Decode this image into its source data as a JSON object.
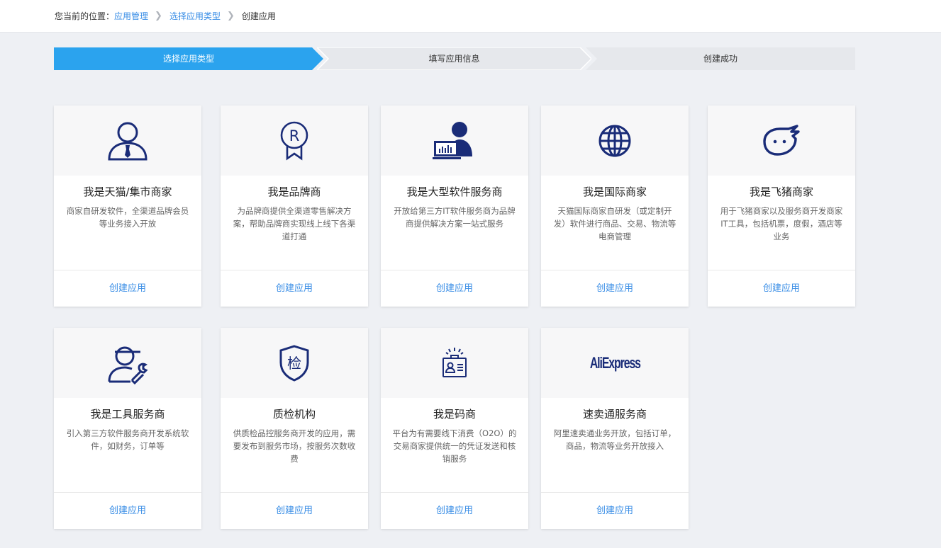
{
  "breadcrumb": {
    "prefix": "您当前的位置：",
    "items": [
      "应用管理",
      "选择应用类型",
      "创建应用"
    ]
  },
  "steps": [
    "选择应用类型",
    "填写应用信息",
    "创建成功"
  ],
  "colors": {
    "accent": "#2ba3ee",
    "link": "#3a8ee6",
    "icon": "#1a2c78"
  },
  "cards": [
    {
      "icon": "user-tie-icon",
      "title": "我是天猫/集市商家",
      "desc": "商家自研发软件，全渠道品牌会员等业务接入开放",
      "action": "创建应用"
    },
    {
      "icon": "registered-badge-icon",
      "title": "我是品牌商",
      "desc": "为品牌商提供全渠道零售解决方案，帮助品牌商实现线上线下各渠道打通",
      "action": "创建应用"
    },
    {
      "icon": "user-computer-icon",
      "title": "我是大型软件服务商",
      "desc": "开放给第三方IT软件服务商为品牌商提供解决方案一站式服务",
      "action": "创建应用"
    },
    {
      "icon": "globe-icon",
      "title": "我是国际商家",
      "desc": "天猫国际商家自研发（或定制开发）软件进行商品、交易、物流等电商管理",
      "action": "创建应用"
    },
    {
      "icon": "fliggy-icon",
      "title": "我是飞猪商家",
      "desc": "用于飞猪商家以及服务商开发商家IT工具，包括机票，度假，酒店等业务",
      "action": "创建应用"
    },
    {
      "icon": "user-wrench-icon",
      "title": "我是工具服务商",
      "desc": "引入第三方软件服务商开发系统软件，如财务，订单等",
      "action": "创建应用"
    },
    {
      "icon": "inspection-shield-icon",
      "title": "质检机构",
      "desc": "供质检品控服务商开发的应用，需要发布到服务市场，按服务次数收费",
      "action": "创建应用",
      "icon_text": "检"
    },
    {
      "icon": "id-badge-icon",
      "title": "我是码商",
      "desc": "平台为有需要线下消费（O2O）的交易商家提供统一的凭证发送和核销服务",
      "action": "创建应用"
    },
    {
      "icon": "aliexpress-logo",
      "title": "速卖通服务商",
      "desc": "阿里速卖通业务开放，包括订单，商品，物流等业务开放接入",
      "action": "创建应用",
      "icon_text": "AliExpress"
    }
  ]
}
